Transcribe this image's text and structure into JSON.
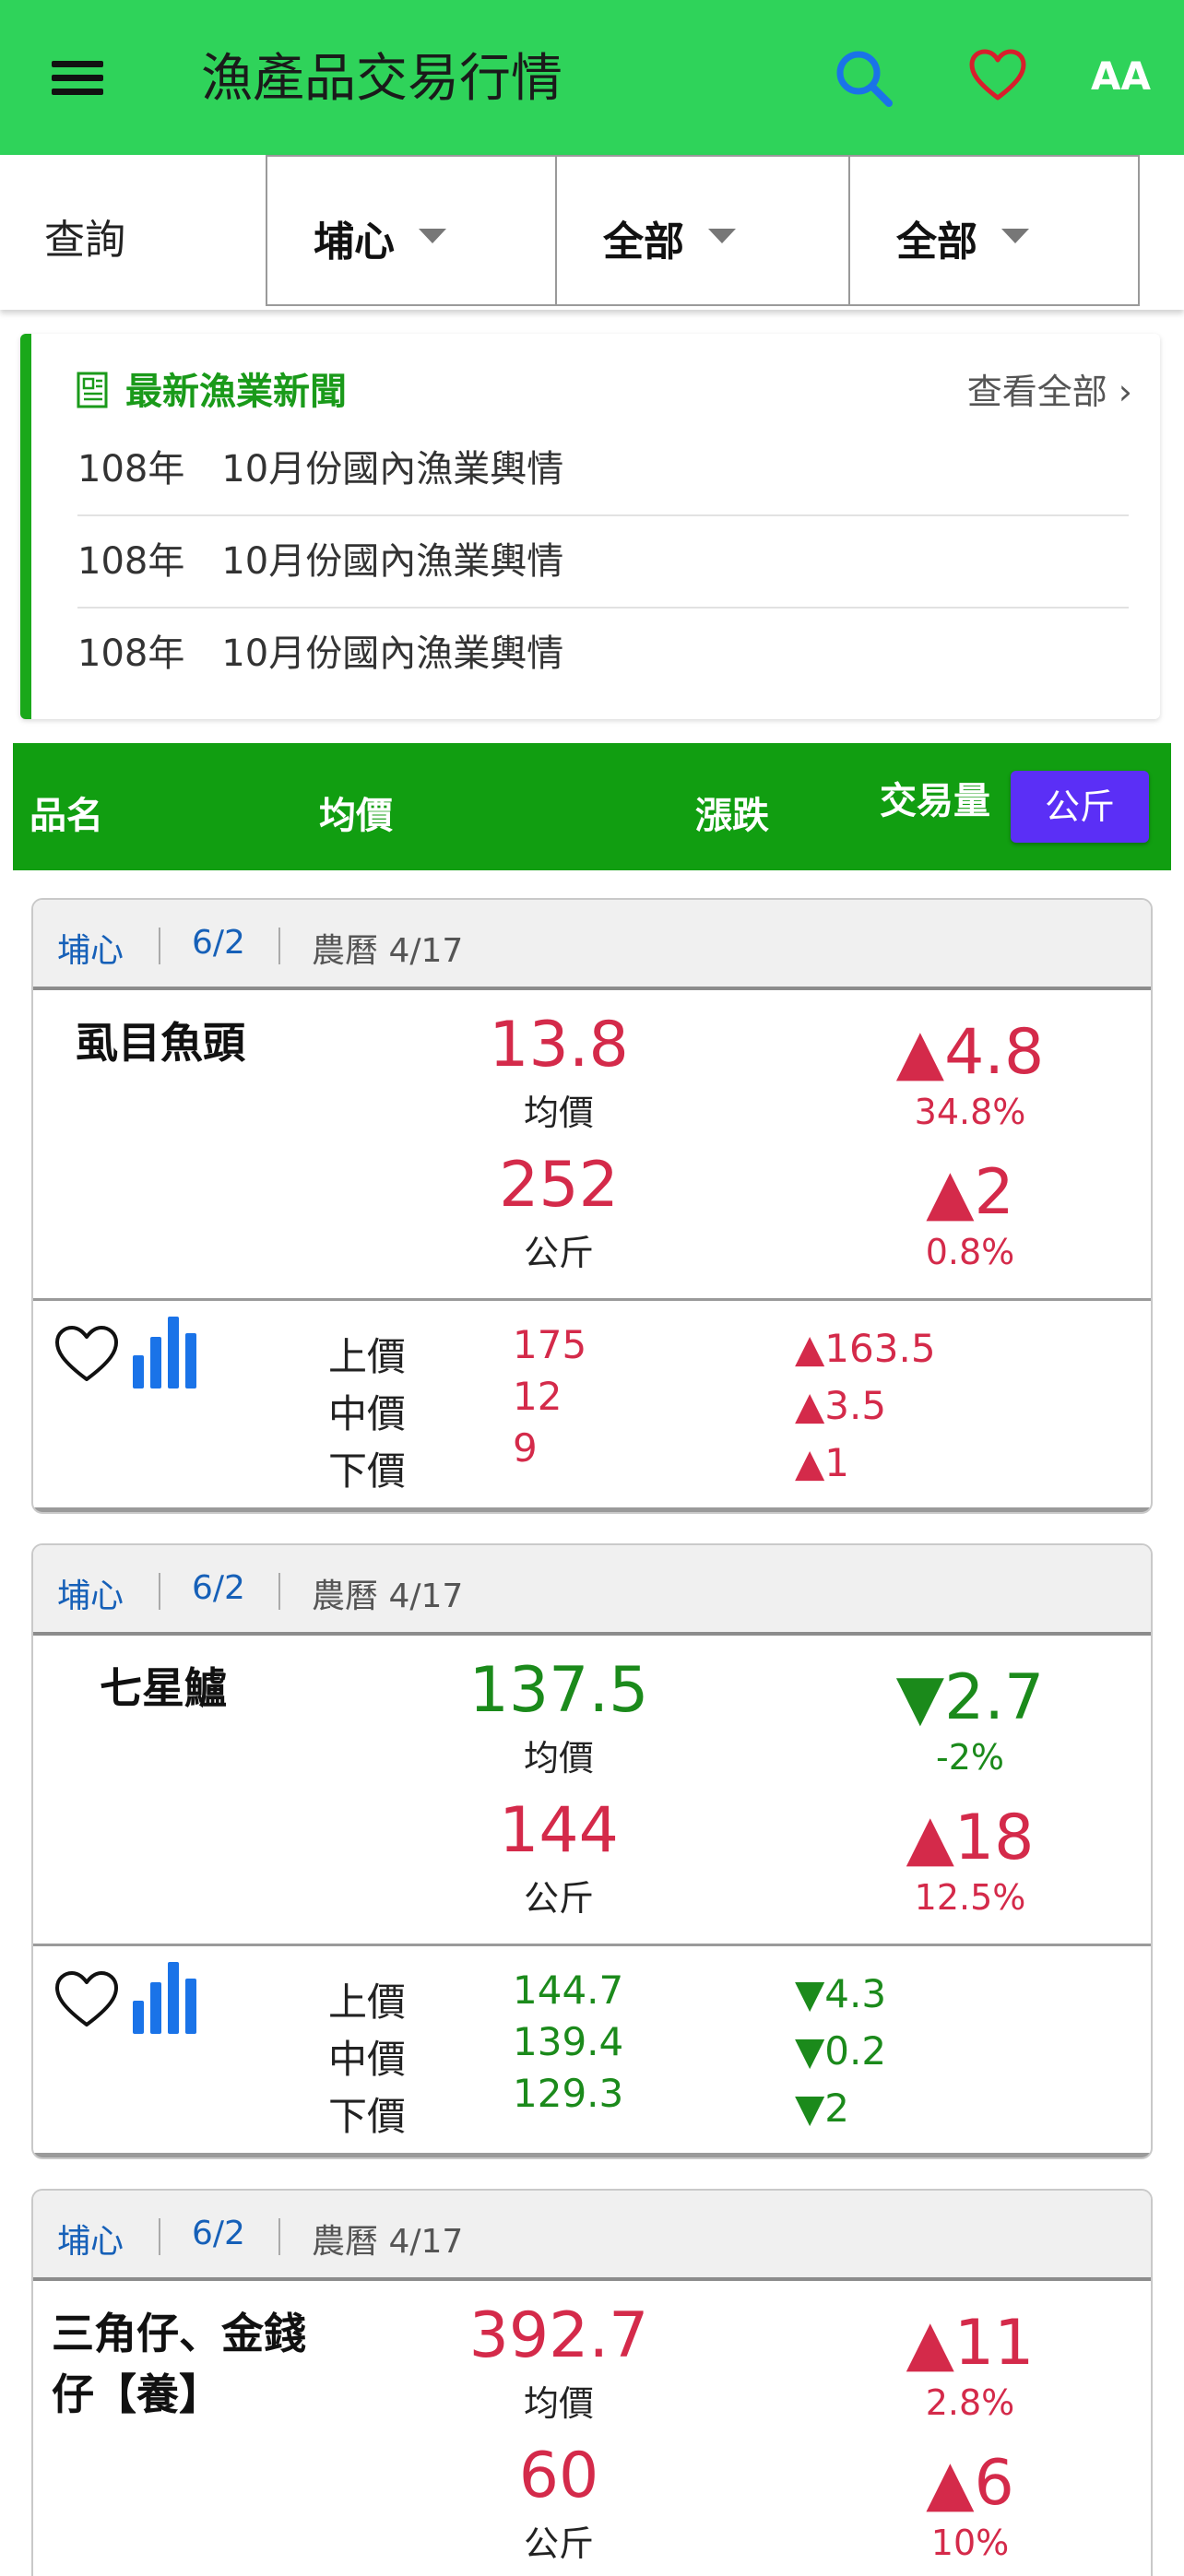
{
  "header": {
    "title": "漁產品交易行情",
    "font_toggle_label": "AA",
    "colors": {
      "bar": "#2fd35a",
      "search": "#1a73e8",
      "heart": "#d81e2c"
    }
  },
  "filters": {
    "query_label": "查詢",
    "market": "埔心",
    "category": "全部",
    "type": "全部"
  },
  "news": {
    "title": "最新漁業新聞",
    "view_all": "查看全部 ›",
    "items": [
      "108年　10月份國內漁業輿情",
      "108年　10月份國內漁業輿情",
      "108年　10月份國內漁業輿情"
    ]
  },
  "columns": {
    "name": "品名",
    "avg": "均價",
    "change": "漲跌",
    "volume": "交易量",
    "unit_button": "公斤"
  },
  "cards": [
    {
      "market": "埔心",
      "date": "6/2",
      "lunar": "農曆 4/17",
      "name": "虱目魚頭",
      "avg_price": "13.8",
      "avg_label": "均價",
      "volume": "252",
      "volume_unit": "公斤",
      "avg_change": "▲4.8",
      "avg_change_pct": "34.8%",
      "vol_change": "▲2",
      "vol_change_pct": "0.8%",
      "prices": [
        {
          "label": "上價",
          "value": "175",
          "change": "▲163.5"
        },
        {
          "label": "中價",
          "value": "12",
          "change": "▲3.5"
        },
        {
          "label": "下價",
          "value": "9",
          "change": "▲1"
        }
      ]
    },
    {
      "market": "埔心",
      "date": "6/2",
      "lunar": "農曆 4/17",
      "name": "七星鱸",
      "avg_price": "137.5",
      "avg_label": "均價",
      "volume": "144",
      "volume_unit": "公斤",
      "avg_change": "▼2.7",
      "avg_change_pct": "-2%",
      "vol_change": "▲18",
      "vol_change_pct": "12.5%",
      "prices": [
        {
          "label": "上價",
          "value": "144.7",
          "change": "▼4.3"
        },
        {
          "label": "中價",
          "value": "139.4",
          "change": "▼0.2"
        },
        {
          "label": "下價",
          "value": "129.3",
          "change": "▼2"
        }
      ]
    },
    {
      "market": "埔心",
      "date": "6/2",
      "lunar": "農曆 4/17",
      "name": "三角仔、金錢仔【養】",
      "avg_price": "392.7",
      "avg_label": "均價",
      "volume": "60",
      "volume_unit": "公斤",
      "avg_change": "▲11",
      "avg_change_pct": "2.8%",
      "vol_change": "▲6",
      "vol_change_pct": "10%"
    }
  ]
}
